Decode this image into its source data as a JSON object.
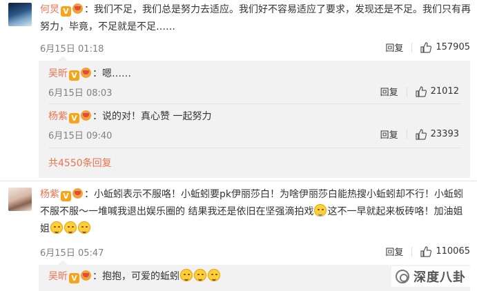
{
  "comments": [
    {
      "author": "何炅",
      "text": "我们不足，我们总是努力去适应。我们好不容易适应了要求，发现还是不足。我们只有再努力，毕竟，不足就是不足……",
      "time": "6月15日 01:18",
      "reply_label": "回复",
      "likes": "157905",
      "replies": [
        {
          "author": "吴昕",
          "text": "嗯……",
          "time": "6月15日 08:03",
          "reply_label": "回复",
          "likes": "21012"
        },
        {
          "author": "杨紫",
          "text": "说的对！真心赞 一起努力",
          "time": "6月15日 09:40",
          "reply_label": "回复",
          "likes": "23393"
        }
      ],
      "more_replies": "共4550条回复"
    },
    {
      "author": "杨紫",
      "text_part1": "小蚯蚓表示不服咯！小蚯蚓要pk伊丽莎白！为啥伊丽莎白能热搜小蚯蚓却不行！小蚯蚓不服不服～一堆喊我退出娱乐圈的 结果我还是依旧在坚强滴拍戏",
      "text_part2": "这不一早就起来板砖咯！加油姐姐",
      "time": "6月15日 05:47",
      "reply_label": "回复",
      "likes": "110065",
      "replies": [
        {
          "author": "吴昕",
          "text": "抱抱，可爱的蚯蚓"
        }
      ]
    }
  ],
  "badge_letter": "V",
  "colon": "：",
  "watermark": "深度八卦",
  "colors": {
    "name": "#eb7350",
    "meta": "#808080",
    "reply_bg": "#f2f2f2",
    "vip": "#f7a41b"
  }
}
